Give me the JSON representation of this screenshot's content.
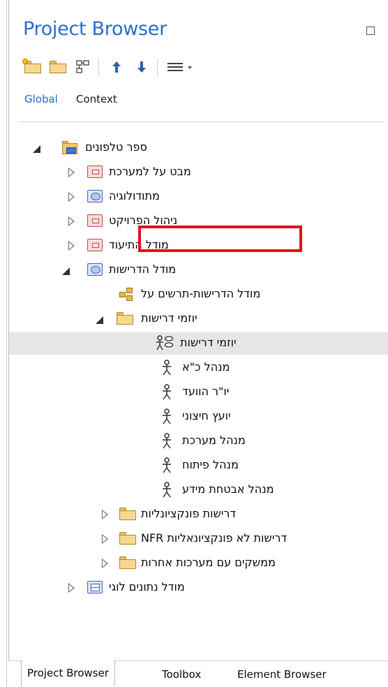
{
  "panel": {
    "title": "Project Browser"
  },
  "toolbar": {
    "buttons": [
      {
        "name": "new-model-button",
        "icon": "new-model-icon"
      },
      {
        "name": "new-folder-button",
        "icon": "folder-icon"
      },
      {
        "name": "new-diagram-button",
        "icon": "diagram-icon"
      },
      {
        "name": "move-up-button",
        "icon": "arrow-up-icon"
      },
      {
        "name": "move-down-button",
        "icon": "arrow-down-icon"
      },
      {
        "name": "menu-button",
        "icon": "hamburger-menu-icon"
      }
    ]
  },
  "subtabs": {
    "global": "Global",
    "context": "Context"
  },
  "tree": {
    "root": "ספר טלפונים",
    "items": {
      "i1": "מבט על למערכת",
      "i2": "מתודולוגיה",
      "i3": "ניהול הפרויקט",
      "i4": "מודל התיעוד",
      "i5": "מודל הדרישות",
      "i6": "מודל הדרישות-תרשים על",
      "i7": "יוזמי דרישות",
      "i8": "יוזמי דרישות",
      "i9": "מנהל כ\"א",
      "i10": "יו\"ר הוועד",
      "i11": "יועץ חיצוני",
      "i12": "מנהל מערכת",
      "i13": "מנהל פיתוח",
      "i14": "מנהל אבטחת מידע",
      "i15": "דרישות פונקציונליות",
      "i16": "דרישות לא פונקציונאליות NFR",
      "i17": "ממשקים עם מערכות אחרות",
      "i18": "מודל נתונים לוגי"
    }
  },
  "bottom_tabs": {
    "project_browser": "Project Browser",
    "toolbox": "Toolbox",
    "element_browser": "Element Browser"
  },
  "colors": {
    "title": "#2b6fd0",
    "highlight": "#e0131b",
    "selected_row": "#e6e6e6"
  }
}
